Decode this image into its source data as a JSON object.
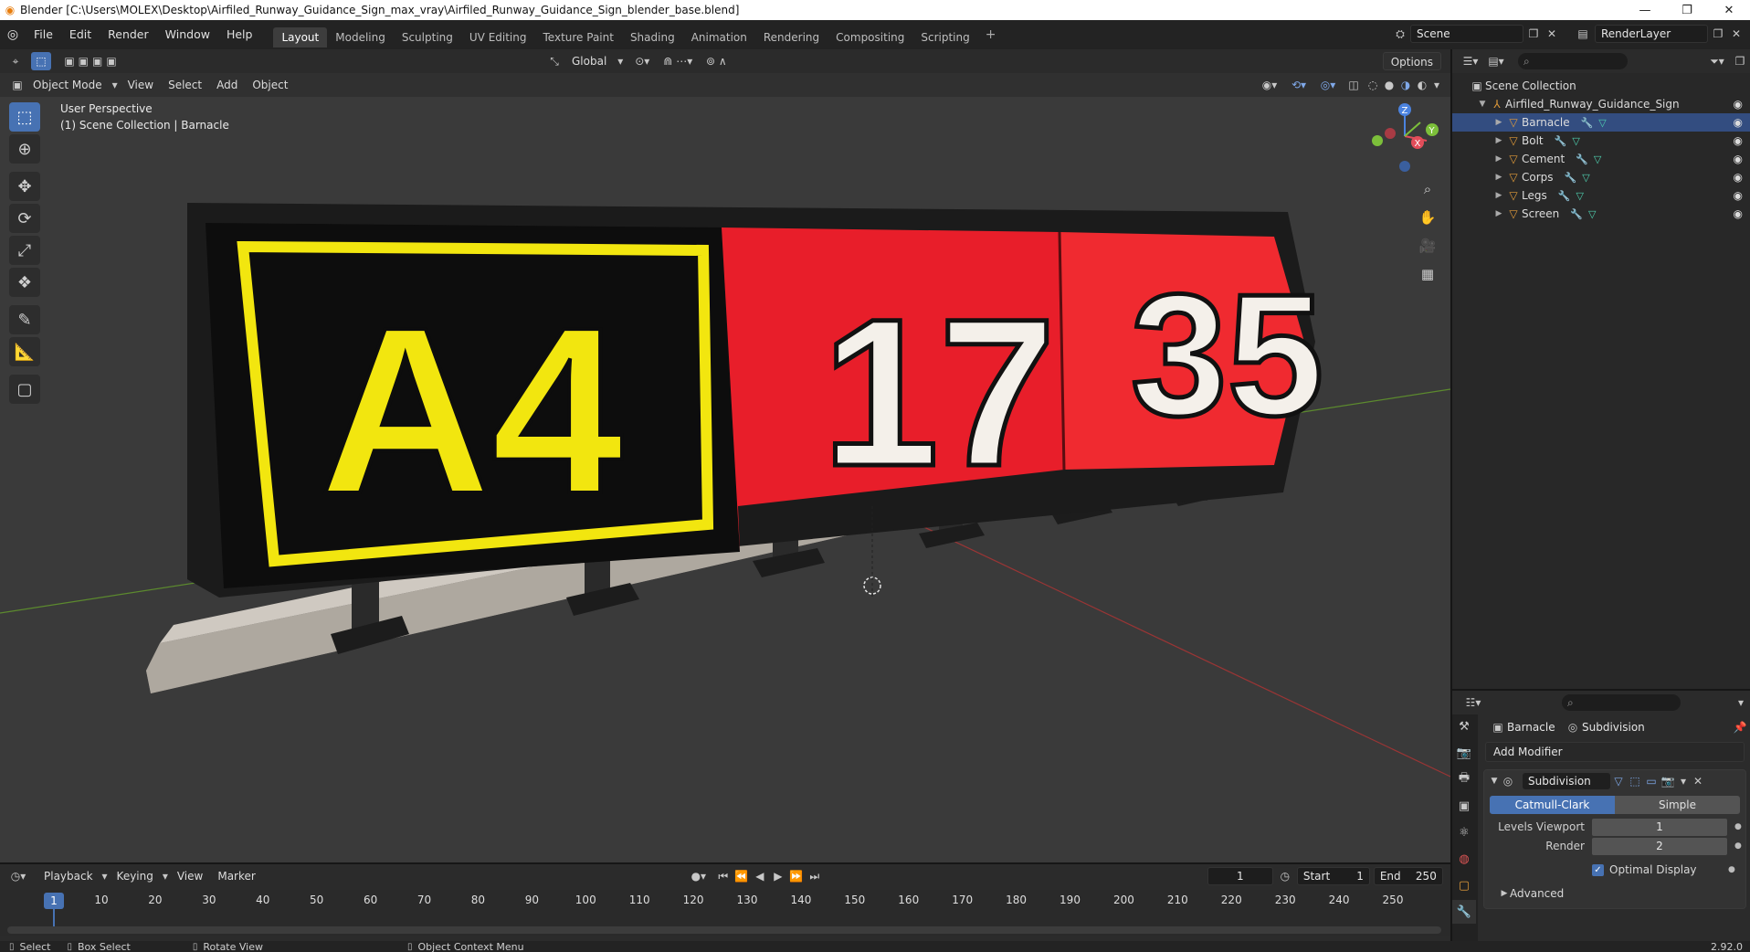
{
  "window": {
    "title": "Blender [C:\\Users\\MOLEX\\Desktop\\Airfiled_Runway_Guidance_Sign_max_vray\\Airfiled_Runway_Guidance_Sign_blender_base.blend]",
    "minimize": "—",
    "maximize": "❐",
    "close": "✕"
  },
  "menu": [
    "File",
    "Edit",
    "Render",
    "Window",
    "Help"
  ],
  "workspaces": [
    {
      "label": "Layout",
      "active": true
    },
    {
      "label": "Modeling"
    },
    {
      "label": "Sculpting"
    },
    {
      "label": "UV Editing"
    },
    {
      "label": "Texture Paint"
    },
    {
      "label": "Shading"
    },
    {
      "label": "Animation"
    },
    {
      "label": "Rendering"
    },
    {
      "label": "Compositing"
    },
    {
      "label": "Scripting"
    }
  ],
  "scene_name": "Scene",
  "render_layer": "RenderLayer",
  "viewport": {
    "transform_orientation": "Global",
    "options_label": "Options",
    "mode": "Object Mode",
    "header_menus": [
      "View",
      "Select",
      "Add",
      "Object"
    ],
    "perspective_line1": "User Perspective",
    "perspective_line2": "(1) Scene Collection | Barnacle",
    "gizmo": {
      "z": "Z",
      "x": "X",
      "y": "Y"
    },
    "sign_panels": {
      "left_text": "A4",
      "middle_text": "17",
      "right_text": "35"
    },
    "colors": {
      "sign_red": "#e81e2a",
      "sign_yellow": "#f2e60f",
      "sign_black": "#0d0d0d",
      "base": "#c9c4bd",
      "grid_bg": "#3a3a3a"
    }
  },
  "outliner": {
    "root": "Scene Collection",
    "collection": "Airfiled_Runway_Guidance_Sign",
    "objects": [
      "Barnacle",
      "Bolt",
      "Cement",
      "Corps",
      "Legs",
      "Screen"
    ]
  },
  "properties": {
    "object_name": "Barnacle",
    "modifier_crumb": "Subdivision",
    "add_modifier": "Add Modifier",
    "modifier": {
      "name": "Subdivision",
      "algorithm_options": [
        "Catmull-Clark",
        "Simple"
      ],
      "selected_algorithm": "Catmull-Clark",
      "levels_viewport_label": "Levels Viewport",
      "levels_viewport": "1",
      "render_label": "Render",
      "render": "2",
      "optimal_display_label": "Optimal Display",
      "optimal_display": true,
      "advanced_label": "Advanced"
    }
  },
  "timeline": {
    "menus": [
      "Playback",
      "Keying",
      "View",
      "Marker"
    ],
    "current_frame": "1",
    "start_label": "Start",
    "start": "1",
    "end_label": "End",
    "end": "250",
    "ticks": [
      "1",
      "10",
      "20",
      "30",
      "40",
      "50",
      "60",
      "70",
      "80",
      "90",
      "100",
      "110",
      "120",
      "130",
      "140",
      "150",
      "160",
      "170",
      "180",
      "190",
      "200",
      "210",
      "220",
      "230",
      "240",
      "250"
    ]
  },
  "status": {
    "select": "Select",
    "box_select": "Box Select",
    "rotate_view": "Rotate View",
    "context_menu": "Object Context Menu",
    "version": "2.92.0"
  }
}
